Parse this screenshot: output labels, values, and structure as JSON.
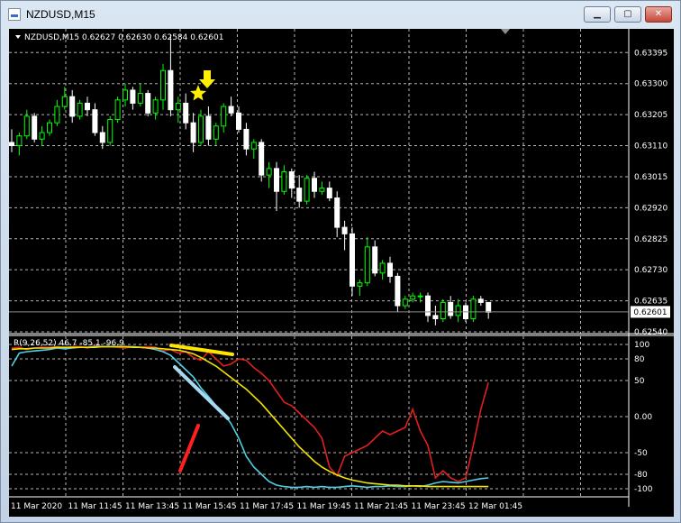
{
  "window": {
    "title": "NZDUSD,M15",
    "controls": {
      "minimize": "▁",
      "maximize": "▢",
      "close": "✕"
    }
  },
  "price_panel": {
    "header": "NZDUSD,M15  0.62627 0.62630 0.62584 0.62601",
    "y_ticks": [
      "0.63395",
      "0.63300",
      "0.63205",
      "0.63110",
      "0.63015",
      "0.62920",
      "0.62825",
      "0.62730",
      "0.62635",
      "0.62540"
    ],
    "current_price": "0.62601",
    "colors": {
      "up": "#00ff00",
      "down": "#ffffff",
      "grid": "#b4b4b4",
      "annotation": "#ffee00"
    }
  },
  "indicator_panel": {
    "header": "R(9,26,52) 46.7 -85.1 -96.9",
    "y_ticks": [
      "100",
      "80",
      "50",
      "0.00",
      "-50",
      "-80",
      "-100"
    ],
    "colors": {
      "fast": "#e0201c",
      "medium": "#4fd0e8",
      "slow": "#f4e400",
      "marker_red": "#ff2020",
      "marker_blue": "#a8d8f0",
      "marker_yellow": "#ffe600"
    }
  },
  "x_axis": {
    "labels": [
      "11 Mar 2020",
      "11 Mar 11:45",
      "11 Mar 13:45",
      "11 Mar 15:45",
      "11 Mar 17:45",
      "11 Mar 19:45",
      "11 Mar 21:45",
      "11 Mar 23:45",
      "12 Mar 01:45"
    ]
  },
  "chart_data": [
    {
      "type": "candlestick",
      "header": "NZDUSD,M15  0.62627 0.62630 0.62584 0.62601",
      "ylim": [
        0.6254,
        0.6344
      ],
      "y_ticks": [
        0.63395,
        0.633,
        0.63205,
        0.6311,
        0.63015,
        0.6292,
        0.62825,
        0.6273,
        0.62635,
        0.6254
      ],
      "x_tick_labels": [
        "11 Mar 2020",
        "11 Mar 11:45",
        "11 Mar 13:45",
        "11 Mar 15:45",
        "11 Mar 17:45",
        "11 Mar 19:45",
        "11 Mar 21:45",
        "11 Mar 23:45",
        "12 Mar 01:45"
      ],
      "ohlc": [
        [
          0.6312,
          0.6316,
          0.6309,
          0.6311
        ],
        [
          0.6311,
          0.6315,
          0.6308,
          0.6314
        ],
        [
          0.6314,
          0.6322,
          0.6313,
          0.632
        ],
        [
          0.632,
          0.6321,
          0.6312,
          0.6313
        ],
        [
          0.6313,
          0.6317,
          0.6311,
          0.6315
        ],
        [
          0.6315,
          0.6319,
          0.6314,
          0.6318
        ],
        [
          0.6318,
          0.6325,
          0.6317,
          0.6323
        ],
        [
          0.6323,
          0.6329,
          0.6322,
          0.6326
        ],
        [
          0.6326,
          0.6328,
          0.6318,
          0.632
        ],
        [
          0.632,
          0.6325,
          0.6319,
          0.6324
        ],
        [
          0.6324,
          0.6326,
          0.632,
          0.6322
        ],
        [
          0.6322,
          0.6324,
          0.6314,
          0.6315
        ],
        [
          0.6315,
          0.6317,
          0.631,
          0.6312
        ],
        [
          0.6312,
          0.632,
          0.6311,
          0.6319
        ],
        [
          0.6319,
          0.6326,
          0.6318,
          0.6325
        ],
        [
          0.6325,
          0.633,
          0.6323,
          0.6328
        ],
        [
          0.6328,
          0.6329,
          0.6322,
          0.6324
        ],
        [
          0.6324,
          0.633,
          0.6323,
          0.6327
        ],
        [
          0.6327,
          0.6328,
          0.632,
          0.6321
        ],
        [
          0.6321,
          0.6326,
          0.6319,
          0.6325
        ],
        [
          0.6325,
          0.6336,
          0.6322,
          0.6334
        ],
        [
          0.6334,
          0.6345,
          0.632,
          0.6322
        ],
        [
          0.6322,
          0.6326,
          0.6318,
          0.6324
        ],
        [
          0.6324,
          0.6327,
          0.6316,
          0.6318
        ],
        [
          0.6318,
          0.6321,
          0.6309,
          0.6312
        ],
        [
          0.6312,
          0.6322,
          0.6311,
          0.632
        ],
        [
          0.632,
          0.6323,
          0.6311,
          0.6313
        ],
        [
          0.6313,
          0.6318,
          0.6311,
          0.6317
        ],
        [
          0.6317,
          0.6324,
          0.6315,
          0.6323
        ],
        [
          0.6323,
          0.6326,
          0.632,
          0.6321
        ],
        [
          0.6321,
          0.6323,
          0.6315,
          0.6316
        ],
        [
          0.6316,
          0.6318,
          0.6308,
          0.631
        ],
        [
          0.631,
          0.6313,
          0.6307,
          0.6312
        ],
        [
          0.6312,
          0.6313,
          0.63,
          0.6302
        ],
        [
          0.6302,
          0.6306,
          0.6298,
          0.6304
        ],
        [
          0.6304,
          0.6306,
          0.6291,
          0.6297
        ],
        [
          0.6297,
          0.6305,
          0.6296,
          0.6303
        ],
        [
          0.6303,
          0.6304,
          0.6295,
          0.6298
        ],
        [
          0.6298,
          0.6302,
          0.6292,
          0.6294
        ],
        [
          0.6294,
          0.6302,
          0.6293,
          0.6301
        ],
        [
          0.6301,
          0.6303,
          0.6295,
          0.6297
        ],
        [
          0.6297,
          0.63,
          0.6296,
          0.6298
        ],
        [
          0.6298,
          0.63,
          0.6294,
          0.6295
        ],
        [
          0.6295,
          0.6297,
          0.6283,
          0.6286
        ],
        [
          0.6286,
          0.6288,
          0.6279,
          0.6284
        ],
        [
          0.6284,
          0.6286,
          0.6265,
          0.6268
        ],
        [
          0.6268,
          0.627,
          0.6265,
          0.6269
        ],
        [
          0.6269,
          0.6283,
          0.6268,
          0.628
        ],
        [
          0.628,
          0.6282,
          0.6271,
          0.6272
        ],
        [
          0.6272,
          0.6276,
          0.627,
          0.6275
        ],
        [
          0.6275,
          0.6277,
          0.6269,
          0.6271
        ],
        [
          0.6271,
          0.6272,
          0.626,
          0.6262
        ],
        [
          0.6262,
          0.6265,
          0.6261,
          0.6264
        ],
        [
          0.6264,
          0.6266,
          0.6263,
          0.6265
        ],
        [
          0.6265,
          0.6266,
          0.6263,
          0.6265
        ],
        [
          0.6265,
          0.6266,
          0.6257,
          0.6259
        ],
        [
          0.6259,
          0.6262,
          0.6256,
          0.6258
        ],
        [
          0.6258,
          0.6264,
          0.6257,
          0.6263
        ],
        [
          0.6263,
          0.6265,
          0.6258,
          0.6259
        ],
        [
          0.6259,
          0.6264,
          0.6257,
          0.6262
        ],
        [
          0.6262,
          0.6263,
          0.6257,
          0.6258
        ],
        [
          0.6258,
          0.6265,
          0.6257,
          0.6264
        ],
        [
          0.6264,
          0.6265,
          0.6262,
          0.6263
        ],
        [
          0.6263,
          0.6263,
          0.6258,
          0.626
        ]
      ],
      "current_price": 0.62601,
      "grid": true
    },
    {
      "type": "line",
      "header": "R(9,26,52) 46.7 -85.1 -96.9",
      "ylim": [
        -110,
        110
      ],
      "y_ticks": [
        100,
        80,
        50,
        0,
        -50,
        -80,
        -100
      ],
      "series": [
        {
          "values": [
            95,
            96,
            93,
            95,
            96,
            96,
            97,
            95,
            97,
            97,
            95,
            98,
            97,
            97,
            96,
            95,
            97,
            96,
            97,
            96,
            91,
            93,
            88,
            90,
            82,
            78,
            90,
            80,
            70,
            73,
            80,
            78,
            68,
            60,
            50,
            35,
            20,
            15,
            5,
            -5,
            -15,
            -30,
            -70,
            -82,
            -55,
            -50,
            -45,
            -40,
            -30,
            -20,
            -25,
            -20,
            -15,
            10,
            -20,
            -40,
            -85,
            -75,
            -85,
            -90,
            -85,
            -40,
            10,
            47
          ]
        },
        {
          "values": [
            70,
            88,
            90,
            91,
            92,
            93,
            95,
            94,
            95,
            96,
            96,
            97,
            97,
            97,
            97,
            97,
            97,
            96,
            95,
            93,
            90,
            85,
            75,
            65,
            55,
            40,
            28,
            15,
            5,
            -10,
            -30,
            -55,
            -70,
            -80,
            -90,
            -95,
            -97,
            -98,
            -98,
            -97,
            -98,
            -97,
            -98,
            -98,
            -97,
            -96,
            -97,
            -98,
            -97,
            -97,
            -96,
            -97,
            -97,
            -96,
            -97,
            -95,
            -92,
            -90,
            -91,
            -92,
            -90,
            -88,
            -86,
            -85
          ]
        },
        {
          "values": [
            93,
            94,
            94,
            95,
            95,
            95,
            96,
            96,
            96,
            96,
            96,
            96,
            97,
            97,
            97,
            97,
            96,
            96,
            95,
            95,
            94,
            93,
            92,
            90,
            87,
            82,
            76,
            70,
            62,
            54,
            46,
            38,
            28,
            18,
            6,
            -6,
            -18,
            -30,
            -42,
            -52,
            -62,
            -70,
            -76,
            -81,
            -85,
            -88,
            -90,
            -92,
            -93,
            -94,
            -95,
            -95,
            -96,
            -96,
            -96,
            -97,
            -97,
            -97,
            -97,
            -97,
            -97,
            -97,
            -97,
            -97
          ]
        }
      ],
      "grid": true
    }
  ]
}
